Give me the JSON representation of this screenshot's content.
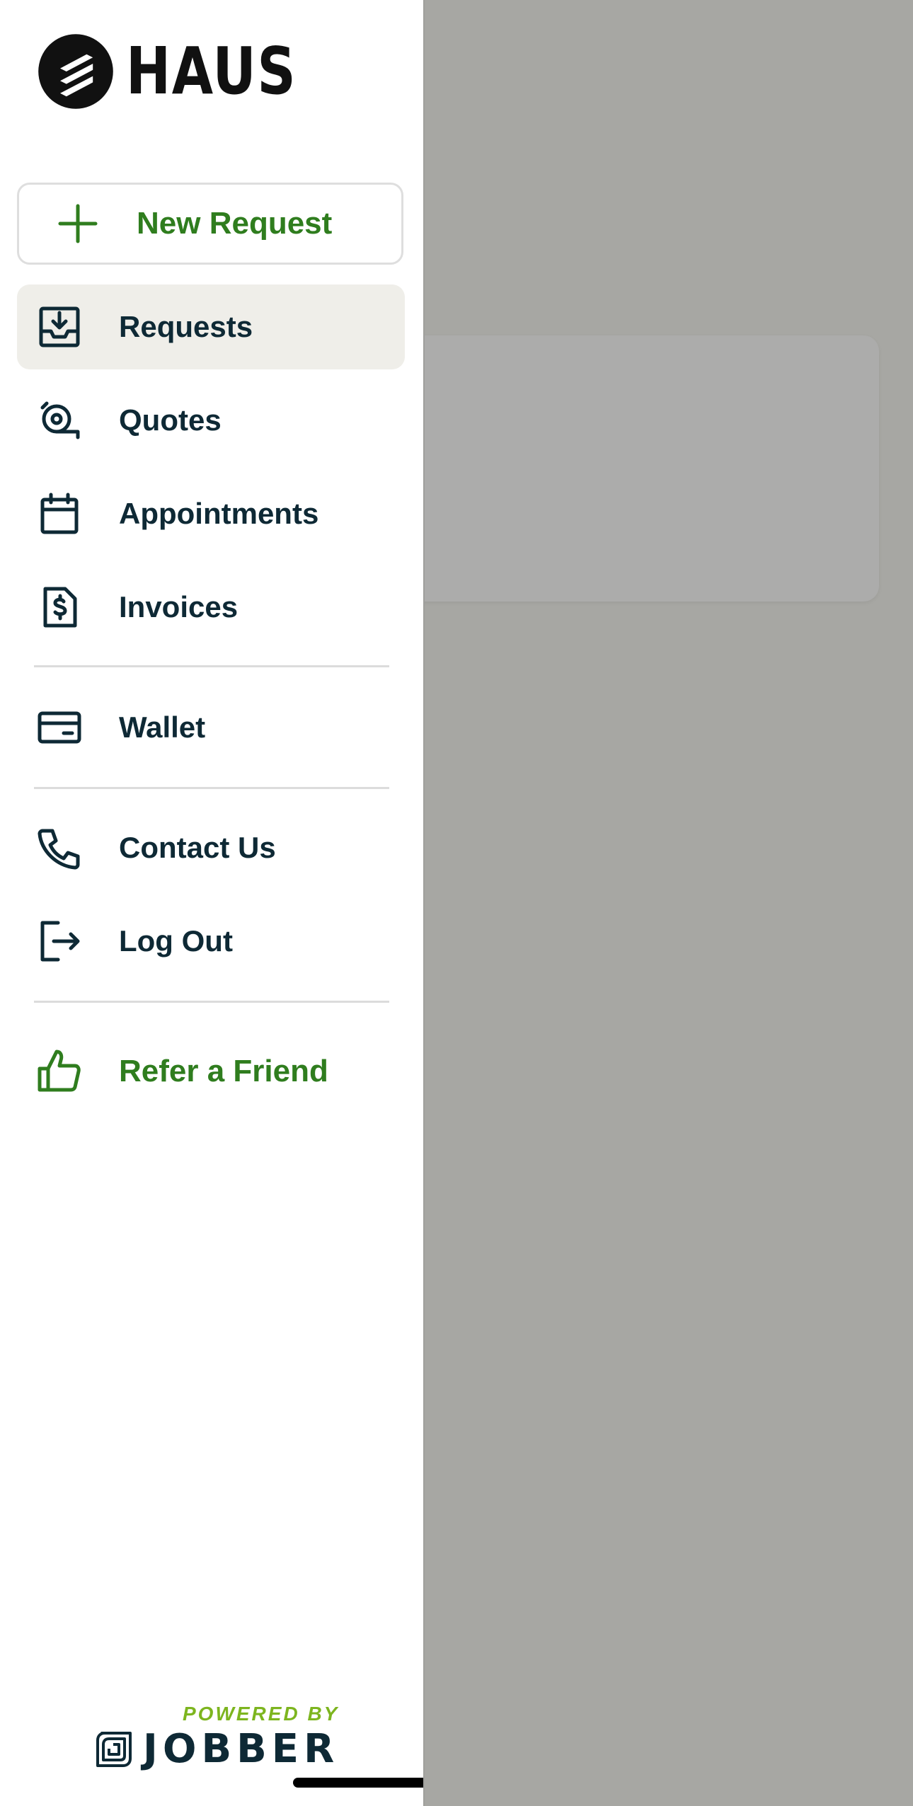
{
  "brand": {
    "name": "HAUS"
  },
  "actions": {
    "new_request_label": "New Request"
  },
  "nav": {
    "items": [
      {
        "label": "Requests",
        "icon": "inbox-download-icon",
        "active": true
      },
      {
        "label": "Quotes",
        "icon": "measuring-tape-icon"
      },
      {
        "label": "Appointments",
        "icon": "calendar-icon"
      },
      {
        "label": "Invoices",
        "icon": "invoice-dollar-icon"
      },
      {
        "label": "Wallet",
        "icon": "credit-card-icon"
      },
      {
        "label": "Contact Us",
        "icon": "phone-icon"
      },
      {
        "label": "Log Out",
        "icon": "logout-icon"
      },
      {
        "label": "Refer a Friend",
        "icon": "thumbs-up-icon"
      }
    ]
  },
  "footer": {
    "powered_by": "POWERED BY",
    "provider": "JOBBER"
  },
  "colors": {
    "accent_green": "#2f7d1e",
    "text_dark": "#0e2935",
    "active_bg": "#efeee9",
    "powered_green": "#7db51f",
    "overlay": "#a7a7a3"
  }
}
